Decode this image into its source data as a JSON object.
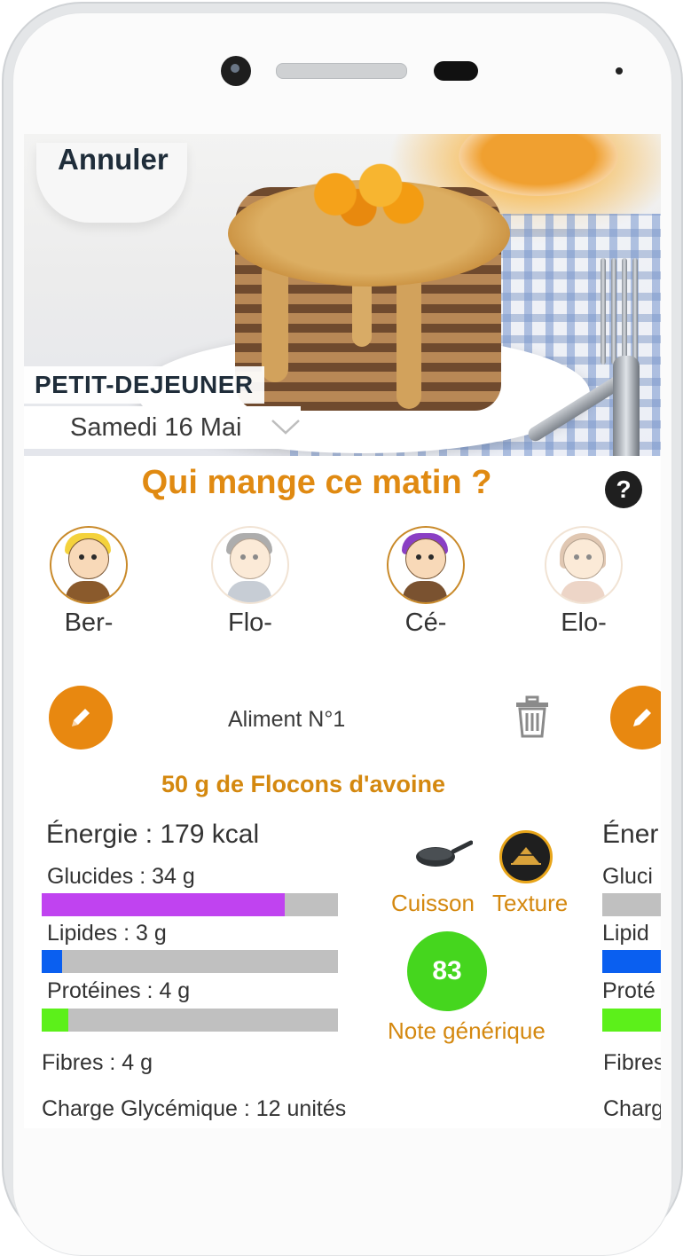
{
  "header": {
    "cancel_label": "Annuler"
  },
  "meal": {
    "type": "PETIT-DEJEUNER",
    "date": "Samedi 16 Mai"
  },
  "question": "Qui mange ce matin ?",
  "help_symbol": "?",
  "eaters": [
    {
      "name": "Ber-",
      "selected": true
    },
    {
      "name": "Flo-",
      "selected": false
    },
    {
      "name": "Cé-",
      "selected": true
    },
    {
      "name": "Elo-",
      "selected": false
    }
  ],
  "food_item": {
    "title": "Aliment N°1",
    "name": "50 g de Flocons d'avoine",
    "energy": "Énergie : 179 kcal",
    "glucides": {
      "label": "Glucides : 34 g",
      "level": 0.82,
      "color": "#c043f0"
    },
    "lipides": {
      "label": "Lipides : 3 g",
      "level": 0.07,
      "color": "#0a5ff0"
    },
    "proteines": {
      "label": "Protéines : 4 g",
      "level": 0.09,
      "color": "#5cf01a"
    },
    "fibres": "Fibres : 4 g",
    "charge": "Charge Glycémique : 12 unités",
    "cuisson_label": "Cuisson",
    "texture_label": "Texture",
    "score": "83",
    "score_label": "Note générique"
  },
  "next_item_peek": {
    "energy": "Éner",
    "glucides": "Gluci",
    "lipides": "Lipid",
    "proteines": "Proté",
    "fibres": "Fibres",
    "charge": "Charg"
  },
  "icons": [
    "pencil-icon",
    "trash-icon",
    "frying-pan-icon",
    "texture-icon",
    "help-icon",
    "chevron-down-icon"
  ]
}
